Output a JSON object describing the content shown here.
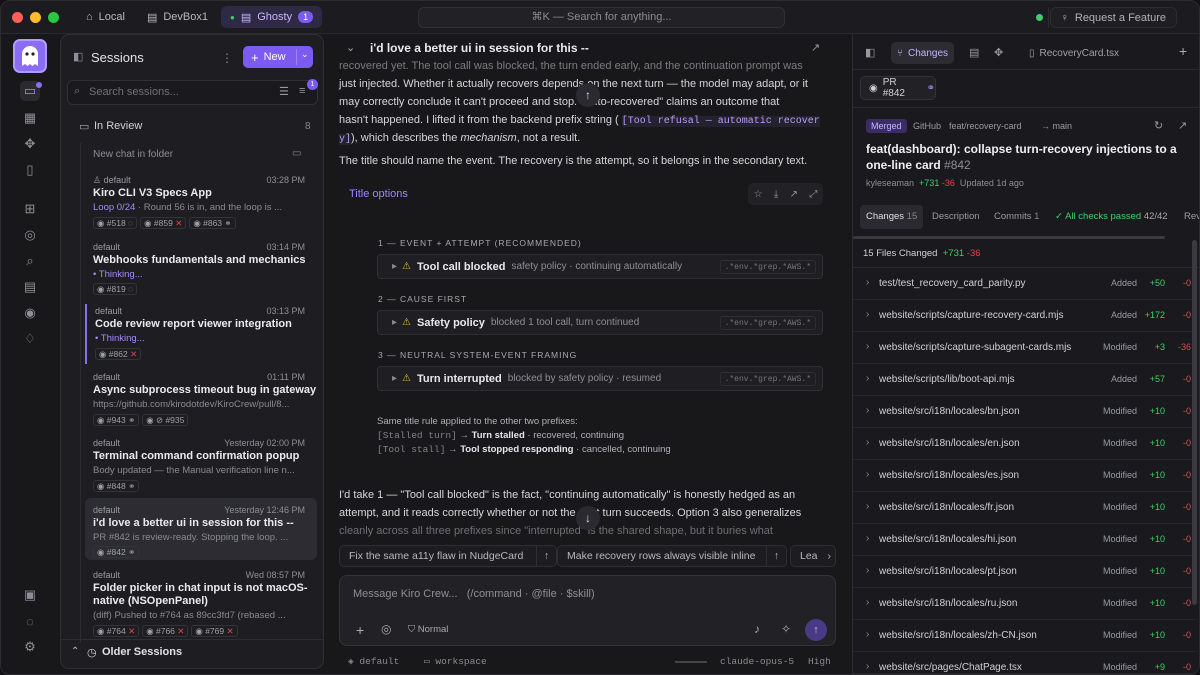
{
  "topbar": {
    "tabs": [
      {
        "label": "Local"
      },
      {
        "label": "DevBox1"
      },
      {
        "label": "Ghosty",
        "badge": "1"
      }
    ],
    "search": "⌘K — Search for anything...",
    "request": "Request a Feature"
  },
  "sessions": {
    "title": "Sessions",
    "new_label": "New",
    "search_placeholder": "Search sessions...",
    "filter_badge": "1",
    "group": {
      "label": "In Review",
      "count": "8"
    },
    "new_chat": "New chat in folder",
    "items": [
      {
        "ws": "default",
        "time": "03:28 PM",
        "title": "Kiro CLI V3 Specs App",
        "sub_a": "Loop 0/24",
        "sub_b": " · Round 56 is in, and the loop is ...",
        "chips": [
          "#518",
          "#859",
          "#863"
        ]
      },
      {
        "ws": "default",
        "time": "03:14 PM",
        "title": "Webhooks fundamentals and mechanics",
        "sub": "Thinking...",
        "chips": [
          "#819"
        ]
      },
      {
        "ws": "default",
        "time": "03:13 PM",
        "title": "Code review report viewer integration",
        "sub": "Thinking...",
        "chips": [
          "#862"
        ]
      },
      {
        "ws": "default",
        "time": "01:11 PM",
        "title": "Async subprocess timeout bug in gateway",
        "sub": "https://github.com/kirodotdev/KiroCrew/pull/8...",
        "chips": [
          "#943",
          "#935"
        ]
      },
      {
        "ws": "default",
        "time": "Yesterday 02:00 PM",
        "title": "Terminal command confirmation popup",
        "sub": "Body updated — the Manual verification line n...",
        "chips": [
          "#848"
        ]
      },
      {
        "ws": "default",
        "time": "Yesterday 12:46 PM",
        "title": "i'd love a better ui in session for this --",
        "sub": "PR #842 is review-ready. Stopping the loop. ...",
        "chips": [
          "#842"
        ]
      },
      {
        "ws": "default",
        "time": "Wed 08:57 PM",
        "title": "Folder picker in chat input is not macOS-",
        "title2": "native (NSOpenPanel)",
        "sub": "(diff) Pushed to #764 as 89cc3fd7 (rebased ...",
        "chips": [
          "#764",
          "#766",
          "#769"
        ]
      }
    ],
    "older": "Older Sessions"
  },
  "chat": {
    "title": "i'd love a better ui in session for this --",
    "p0": "recovered yet. The tool call was blocked, the turn ended early, and the continuation prompt was",
    "p1": "just injected. Whether it actually recovers depends on the next turn — the model may adapt, or it",
    "p2": "may correctly conclude it can't proceed and stop. \"Auto-recovered\" claims an outcome that",
    "p3a": "hasn't happened. I lifted it from the backend prefix string (",
    "p3m": "[Tool refusal — automatic recover",
    "p4m": "y]",
    "p4b": "), which describes the ",
    "p4i": "mechanism",
    "p4c": ", not a result.",
    "p5": "The title should name the event. The recovery is the attempt, so it belongs in the secondary text.",
    "card": {
      "title": "Title options",
      "options": [
        {
          "cap": "1 — EVENT + ATTEMPT (RECOMMENDED)",
          "title": "Tool call blocked",
          "sub": "safety policy · continuing automatically",
          "pill": ".*env.*grep.*AWS.*"
        },
        {
          "cap": "2 — CAUSE FIRST",
          "title": "Safety policy",
          "sub": "blocked 1 tool call, turn continued",
          "pill": ".*env.*grep.*AWS.*"
        },
        {
          "cap": "3 — NEUTRAL SYSTEM-EVENT FRAMING",
          "title": "Turn interrupted",
          "sub": "blocked by safety policy · resumed",
          "pill": ".*env.*grep.*AWS.*"
        }
      ],
      "note": "Same title rule applied to the other two prefixes:",
      "n1m": "[Stalled turn]",
      "n1b": "Turn stalled",
      "n1c": " · recovered, continuing",
      "n2m": "[Tool stall]",
      "n2b": "Tool stopped responding",
      "n2c": " · cancelled, continuing"
    },
    "p6": "I'd take 1 — \"Tool call blocked\" is the fact, \"continuing automatically\" is honestly hedged as an",
    "p7": "attempt, and it reads correctly whether or not the next turn succeeds. Option 3 also generalizes",
    "p8": "cleanly across all three prefixes since \"interrupted\" is the shared shape, but it buries what",
    "suggestions": [
      "Fix the same a11y flaw in NudgeCard",
      "Make recovery rows always visible inline",
      "Lea"
    ],
    "composer_placeholder": "Message Kiro Crew...",
    "composer_hint": "(/command · @file · $skill)",
    "mode": "Normal",
    "footer": {
      "ws": "default",
      "folder": "workspace",
      "model": "claude-opus-5",
      "effort": "High"
    }
  },
  "right": {
    "tabs": {
      "changes": "Changes",
      "file": "RecoveryCard.tsx"
    },
    "pr": "PR #842",
    "merged": "Merged",
    "src": "GitHub",
    "branch": "feat/recovery-card",
    "target": "main",
    "title": "feat(dashboard): collapse turn-recovery injections to a one-line card",
    "num": "#842",
    "author": "kyleseaman",
    "adds": "+731",
    "dels": "-36",
    "updated": "Updated 1d ago",
    "subtabs": {
      "changes": "Changes",
      "changes_n": "15",
      "desc": "Description",
      "commits": "Commits",
      "commits_n": "1",
      "checks": "All checks passed",
      "checks_n": "42/42",
      "rev": "Rev"
    },
    "files_header": "15 Files Changed",
    "fh_add": "+731",
    "fh_del": "-36",
    "files": [
      {
        "name": "test/test_recovery_card_parity.py",
        "status": "Added",
        "add": "+50",
        "del": "-0"
      },
      {
        "name": "website/scripts/capture-recovery-card.mjs",
        "status": "Added",
        "add": "+172",
        "del": "-0"
      },
      {
        "name": "website/scripts/capture-subagent-cards.mjs",
        "status": "Modified",
        "add": "+3",
        "del": "-36"
      },
      {
        "name": "website/scripts/lib/boot-api.mjs",
        "status": "Added",
        "add": "+57",
        "del": "-0"
      },
      {
        "name": "website/src/i18n/locales/bn.json",
        "status": "Modified",
        "add": "+10",
        "del": "-0"
      },
      {
        "name": "website/src/i18n/locales/en.json",
        "status": "Modified",
        "add": "+10",
        "del": "-0"
      },
      {
        "name": "website/src/i18n/locales/es.json",
        "status": "Modified",
        "add": "+10",
        "del": "-0"
      },
      {
        "name": "website/src/i18n/locales/fr.json",
        "status": "Modified",
        "add": "+10",
        "del": "-0"
      },
      {
        "name": "website/src/i18n/locales/hi.json",
        "status": "Modified",
        "add": "+10",
        "del": "-0"
      },
      {
        "name": "website/src/i18n/locales/pt.json",
        "status": "Modified",
        "add": "+10",
        "del": "-0"
      },
      {
        "name": "website/src/i18n/locales/ru.json",
        "status": "Modified",
        "add": "+10",
        "del": "-0"
      },
      {
        "name": "website/src/i18n/locales/zh-CN.json",
        "status": "Modified",
        "add": "+10",
        "del": "-0"
      },
      {
        "name": "website/src/pages/ChatPage.tsx",
        "status": "Modified",
        "add": "+9",
        "del": "-0"
      }
    ]
  }
}
